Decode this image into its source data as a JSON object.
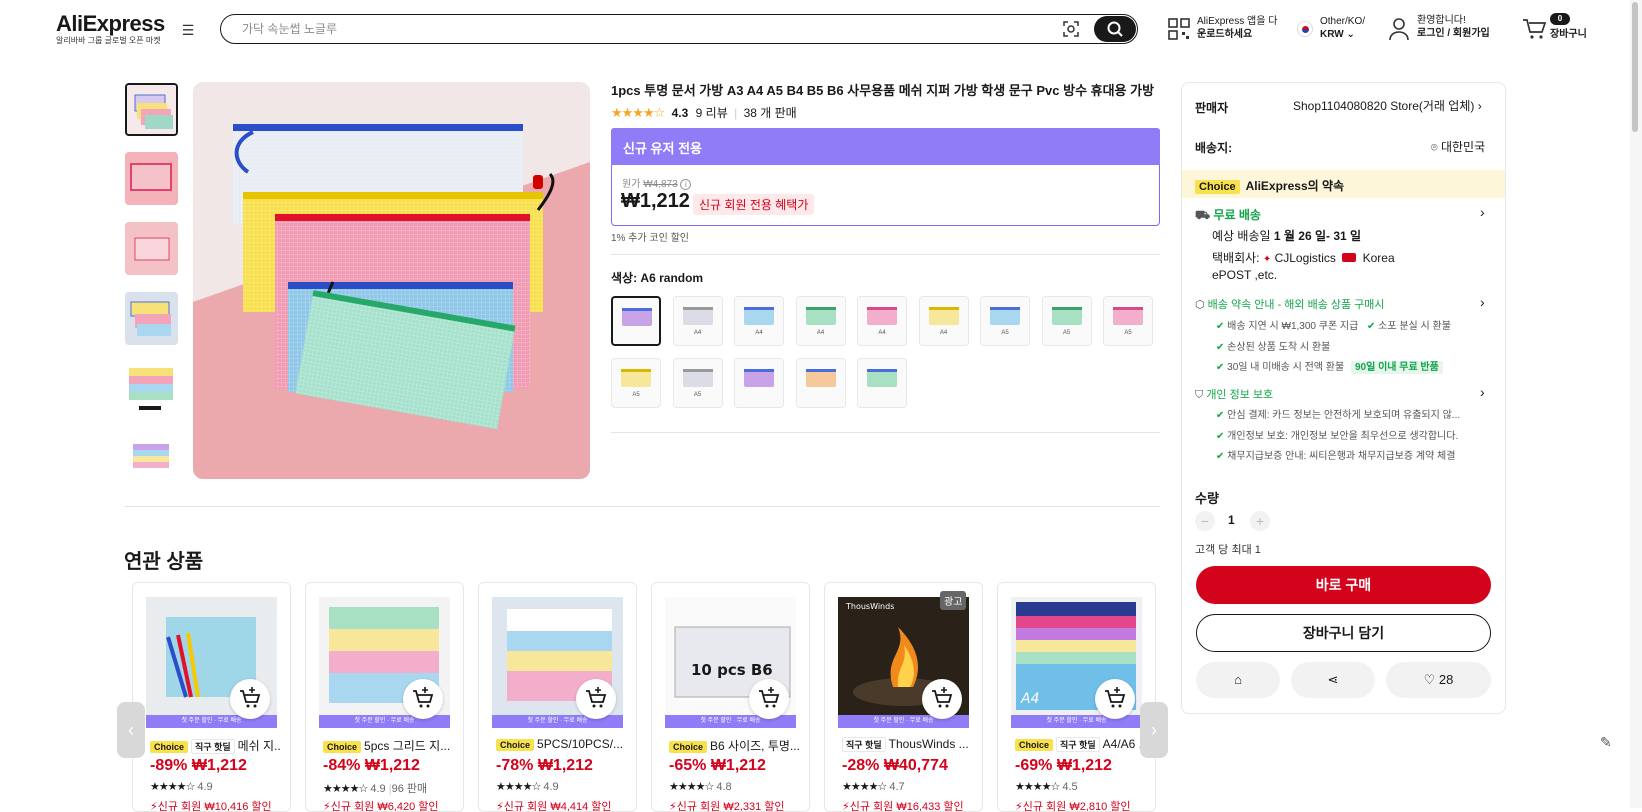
{
  "header": {
    "logo": "AliExpress",
    "logo_sub": "알리바바 그룹 글로벌 오픈 마켓",
    "search_placeholder": "가닥 속눈썹 노글루",
    "app_line1": "AliExpress 앱을 다",
    "app_line2": "운로드하세요",
    "region_line1": "Other/KO/",
    "region_line2": "KRW",
    "account_line1": "환영합니다!",
    "account_line2": "로그인 / 회원가입",
    "cart_count": "0",
    "cart_label": "장바구니"
  },
  "product": {
    "title": "1pcs 투명 문서 가방 A3 A4 A5 B4 B5 B6 사무용품 메쉬 지퍼 가방 학생 문구 Pvc 방수 휴대용 가방",
    "rating": "4.3",
    "reviews": "9 리뷰",
    "sold": "38 개 판매",
    "newuser_header": "신규 유저 전용",
    "original_label": "원가",
    "original_price": "₩4,873",
    "price": "₩1,212",
    "newuser_badge": "신규 회원 전용 혜택가",
    "coin_discount": "1% 추가 코인 할인",
    "color_label": "색상:",
    "color_value": "A6 random",
    "swatches": [
      {
        "label": "",
        "color": "#c9a3e8",
        "zip": "#4a6edb"
      },
      {
        "label": "A4",
        "color": "#dcdce6",
        "zip": "#999"
      },
      {
        "label": "A4",
        "color": "#a9d7f0",
        "zip": "#4a6edb"
      },
      {
        "label": "A4",
        "color": "#a8e0c4",
        "zip": "#3aa36b"
      },
      {
        "label": "A4",
        "color": "#f3aecb",
        "zip": "#d64a8a"
      },
      {
        "label": "A4",
        "color": "#f6e79a",
        "zip": "#d8b800"
      },
      {
        "label": "A5",
        "color": "#a9d7f0",
        "zip": "#4a6edb"
      },
      {
        "label": "A5",
        "color": "#a8e0c4",
        "zip": "#3aa36b"
      },
      {
        "label": "A5",
        "color": "#f3aecb",
        "zip": "#d64a8a"
      },
      {
        "label": "A5",
        "color": "#f6e79a",
        "zip": "#d8b800"
      },
      {
        "label": "A5",
        "color": "#dcdce6",
        "zip": "#999"
      },
      {
        "label": "",
        "color": "#c9a3e8",
        "zip": "#4a6edb"
      },
      {
        "label": "",
        "color": "#f6c99a",
        "zip": "#4a6edb"
      },
      {
        "label": "",
        "color": "#a8e0c4",
        "zip": "#4a6edb"
      }
    ]
  },
  "seller_panel": {
    "seller_label": "판매자",
    "seller_name": "Shop1104080820 Store(거래 업체)",
    "ship_to_label": "배송지:",
    "ship_to": "대한민국",
    "choice_badge": "Choice",
    "choice_promise": "AliExpress의 약속",
    "free_shipping": "무료 배송",
    "delivery_prefix": "예상 배송일",
    "delivery_dates": "1 월 26 일- 31 일",
    "courier_label": "택배회사:",
    "courier_1": "CJLogistics",
    "courier_2": "Korea",
    "courier_3": "ePOST ,etc.",
    "guarantee_title": "배송 약속 안내 - 해외 배송 상품 구매시",
    "guarantee_items": [
      "배송 지연 시 ₩1,300 쿠폰 지급",
      "소포 분실 시 환불",
      "손상된 상품 도착 시 환불",
      "30일 내 미배송 시 전액 환불"
    ],
    "return_badge": "90일 이내 무료 반품",
    "privacy_title": "개인 정보 보호",
    "privacy_items": [
      "안심 결제: 카드 정보는 안전하게 보호되며 유출되지 않...",
      "개인정보 보호: 개인정보 보안을 최우선으로 생각합니다.",
      "채무지급보증 안내: 씨티은행과 채무지급보증 계약 체결"
    ],
    "qty_label": "수량",
    "qty_value": "1",
    "limit": "고객 당 최대 1",
    "buy_now": "바로 구매",
    "add_cart": "장바구니 담기",
    "wishlist_count": "28"
  },
  "related": {
    "title": "연관 상품",
    "strip_text": "첫 주문 할인 · 무료 배송",
    "ad_label": "광고",
    "items": [
      {
        "choice": "Choice",
        "hot": "직구 핫딜",
        "title": "메쉬 지...",
        "discount": "-89%",
        "price": "₩1,212",
        "rating": "4.9",
        "sold": "",
        "promo": "신규 회원 ₩10,416 할인"
      },
      {
        "choice": "Choice",
        "hot": "",
        "title": "5pcs 그리드 지...",
        "discount": "-84%",
        "price": "₩1,212",
        "rating": "4.9",
        "sold": "96 판매",
        "promo": "신규 회원 ₩6,420 할인"
      },
      {
        "choice": "Choice",
        "hot": "",
        "title": "5PCS/10PCS/...",
        "discount": "-78%",
        "price": "₩1,212",
        "rating": "4.9",
        "sold": "",
        "promo": "신규 회원 ₩4,414 할인"
      },
      {
        "choice": "Choice",
        "hot": "",
        "title": "B6 사이즈, 투명...",
        "discount": "-65%",
        "price": "₩1,212",
        "rating": "4.8",
        "sold": "",
        "promo": "신규 회원 ₩2,331 할인"
      },
      {
        "choice": "",
        "hot": "직구 핫딜",
        "title": "ThousWinds ...",
        "discount": "-28%",
        "price": "₩40,774",
        "rating": "4.7",
        "sold": "",
        "promo": "신규 회원 ₩16,433 할인"
      },
      {
        "choice": "Choice",
        "hot": "직구 핫딜",
        "title": "A4/A6 ...",
        "discount": "-69%",
        "price": "₩1,212",
        "rating": "4.5",
        "sold": "",
        "promo": "신규 회원 ₩2,810 할인"
      }
    ]
  },
  "image_text": {
    "b6_label": "10 pcs B6",
    "thouswinds_logo": "ThousWinds",
    "a4_label": "A4"
  },
  "colors": {
    "accent_red": "#d3031c",
    "purple": "#8f7cf6",
    "green": "#11a54a",
    "choice_yellow": "#f7e14d"
  }
}
